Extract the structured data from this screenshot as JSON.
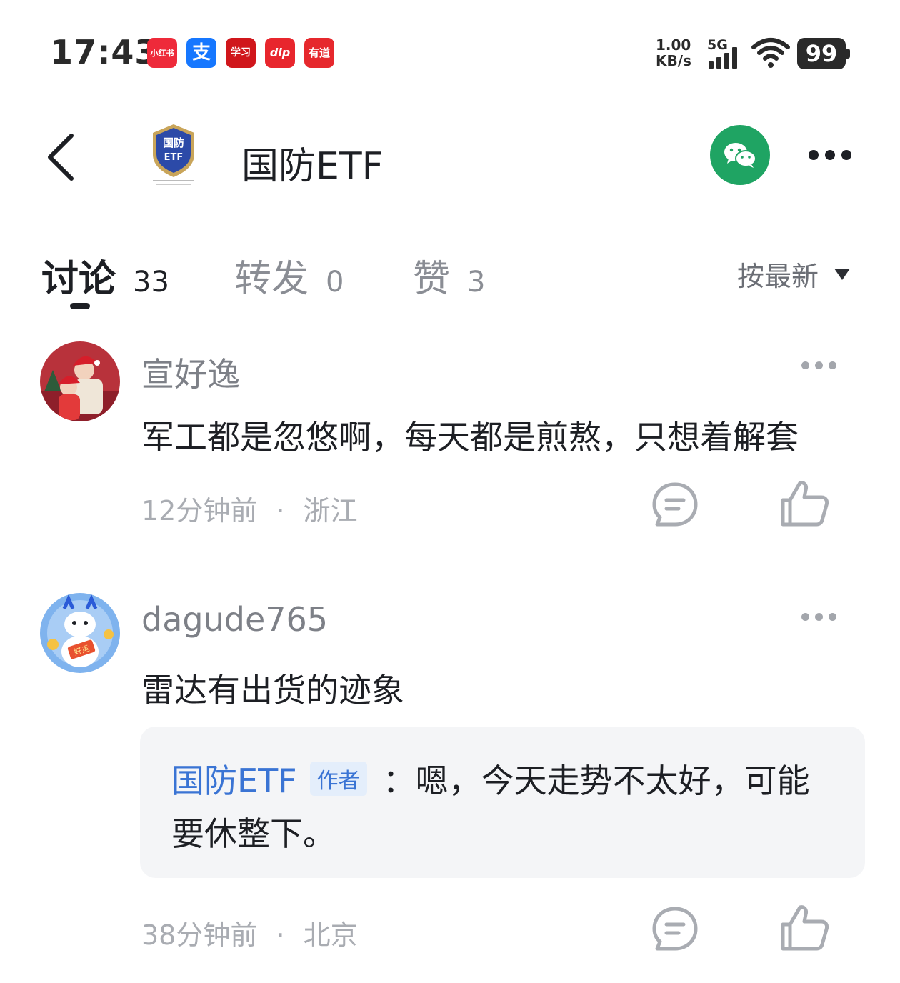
{
  "status_bar": {
    "time": "17:43",
    "notifications": [
      {
        "name": "xiaohongshu-app-icon",
        "label": "小红书",
        "color": "#ee2a3a"
      },
      {
        "name": "alipay-app-icon",
        "label": "支",
        "color": "#1677ff"
      },
      {
        "name": "xuexi-app-icon",
        "label": "学习",
        "color": "#d0161b"
      },
      {
        "name": "dlp-app-icon",
        "label": "dlp",
        "color": "#e8262d"
      },
      {
        "name": "youdao-app-icon",
        "label": "有道",
        "color": "#e6282d"
      }
    ],
    "net_speed_value": "1.00",
    "net_speed_unit": "KB/s",
    "network_type": "5G",
    "battery": "99"
  },
  "header": {
    "title": "国防ETF",
    "logo_text": "国防",
    "logo_subtext": "ETF",
    "wechat_icon": "wechat-icon"
  },
  "tabs": [
    {
      "label": "讨论",
      "count": "33",
      "active": true
    },
    {
      "label": "转发",
      "count": "0",
      "active": false
    },
    {
      "label": "赞",
      "count": "3",
      "active": false
    }
  ],
  "sort_label": "按最新",
  "comments": [
    {
      "username": "宣好逸",
      "content": "军工都是忽悠啊，每天都是煎熬，只想着解套",
      "time": "12分钟前",
      "separator": "·",
      "location": "浙江"
    },
    {
      "username": "dagude765",
      "content": "雷达有出货的迹象",
      "avatar_badge": "好运",
      "reply": {
        "author": "国防ETF",
        "tag": "作者",
        "text_line1": "：嗯，今天走势不太好，可能",
        "text_line2": "要休整下。"
      },
      "time": "38分钟前",
      "separator": "·",
      "location": "北京"
    }
  ]
}
